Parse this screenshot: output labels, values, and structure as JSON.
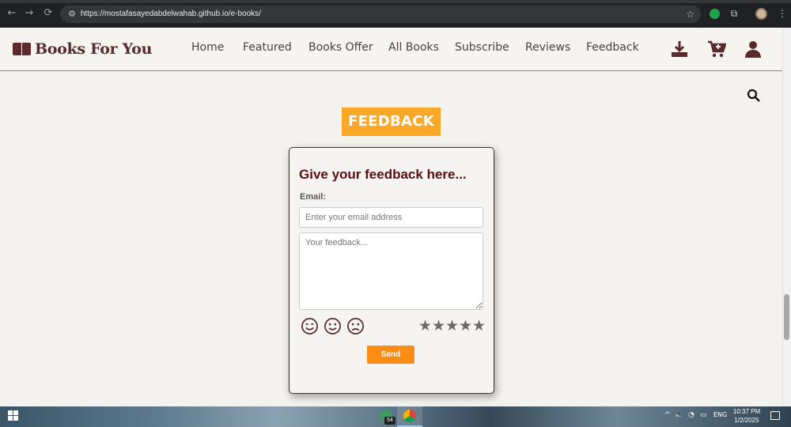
{
  "browser": {
    "url": "https://mostafasayedabdelwahab.github.io/e-books/",
    "back_icon": "←",
    "forward_icon": "→",
    "reload_icon": "⟳",
    "tune_icon": "⚙",
    "star_icon": "☆",
    "puzzle_icon": "⧉",
    "menu_icon": "⋮"
  },
  "header": {
    "logo_text": "Books For You",
    "nav": [
      "Home",
      "Featured",
      "Books Offer",
      "All Books",
      "Subscribe",
      "Reviews",
      "Feedback"
    ]
  },
  "section": {
    "title": "FEEDBACK"
  },
  "form": {
    "heading": "Give your feedback here...",
    "email_label": "Email:",
    "email_placeholder": "Enter your email address",
    "feedback_placeholder": "Your feedback...",
    "stars": [
      "★",
      "★",
      "★",
      "★",
      "★"
    ],
    "send_label": "Send"
  },
  "taskbar": {
    "badge": "54",
    "language": "ENG",
    "time": "10:37 PM",
    "date": "1/2/2025",
    "tray_chevron": "^",
    "volume_icon": "🔈",
    "wifi_icon": "◔",
    "battery_icon": "▭"
  },
  "colors": {
    "brand": "#5a2a2c",
    "section_badge": "#fba727",
    "send_button": "#fb8c14"
  }
}
